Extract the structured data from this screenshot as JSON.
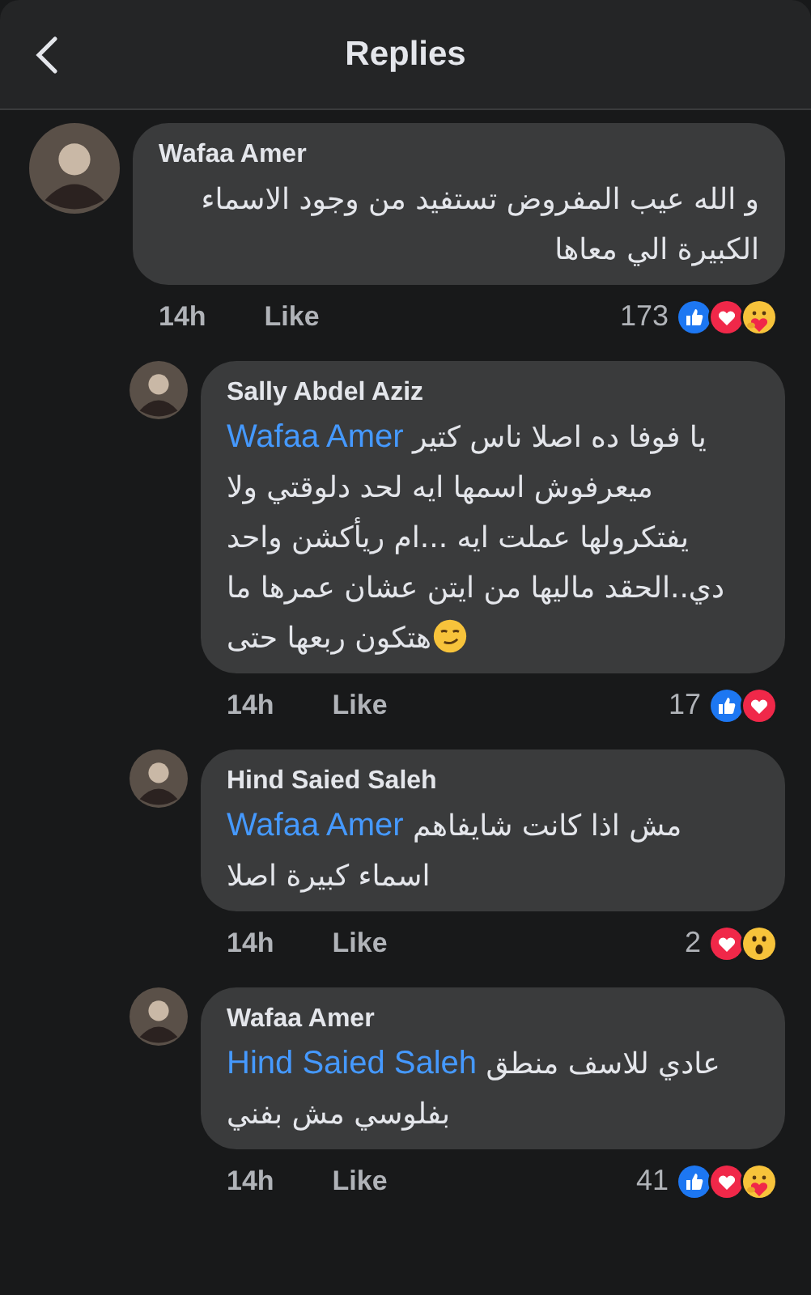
{
  "header": {
    "title": "Replies"
  },
  "comment": {
    "author": "Wafaa Amer",
    "segments": [
      {
        "kind": "text",
        "text": "و الله عيب المفروض تستفيد من وجود الاسماء الكبيرة الي معاها"
      }
    ],
    "time": "14h",
    "like": "Like",
    "count": "173",
    "reactions": [
      {
        "kind": "like"
      },
      {
        "kind": "love"
      },
      {
        "kind": "care"
      }
    ]
  },
  "replies": [
    {
      "author": "Sally Abdel Aziz",
      "segments": [
        {
          "kind": "mention",
          "text": "Wafaa Amer"
        },
        {
          "kind": "text",
          "text": " يا فوفا ده اصلا ناس كتير ميعرفوش اسمها ايه لحد دلوقتي ولا يفتكرولها عملت ايه ...ام ريأكشن واحد دي..الحقد ماليها من ايتن عشان عمرها ما "
        },
        {
          "kind": "emoji"
        },
        {
          "kind": "text",
          "text": "هتكون ربعها حتى"
        }
      ],
      "time": "14h",
      "like": "Like",
      "count": "17",
      "reactions": [
        {
          "kind": "like"
        },
        {
          "kind": "love"
        }
      ]
    },
    {
      "author": "Hind Saied Saleh",
      "segments": [
        {
          "kind": "mention",
          "text": "Wafaa Amer"
        },
        {
          "kind": "text",
          "text": " مش اذا كانت شايفاهم اسماء كبيرة اصلا"
        }
      ],
      "time": "14h",
      "like": "Like",
      "count": "2",
      "reactions": [
        {
          "kind": "love"
        },
        {
          "kind": "wow"
        }
      ]
    },
    {
      "author": "Wafaa Amer",
      "segments": [
        {
          "kind": "mention",
          "text": "Hind Saied Saleh"
        },
        {
          "kind": "text",
          "text": "  عادي للاسف منطق بفلوسي مش بفني"
        }
      ],
      "time": "14h",
      "like": "Like",
      "count": "41",
      "reactions": [
        {
          "kind": "like"
        },
        {
          "kind": "love"
        },
        {
          "kind": "care"
        }
      ]
    }
  ]
}
